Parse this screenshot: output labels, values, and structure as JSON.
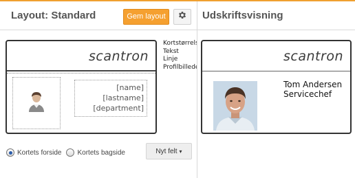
{
  "accent_color": "#f0a030",
  "layout_panel": {
    "title": "Layout: Standard",
    "save_button_label": "Gem layout",
    "settings_icon": "gear-icon",
    "card": {
      "logo": "scantron",
      "placeholder_icon": "person-icon",
      "placeholder_line1": "[name] [lastname]",
      "placeholder_line2": "[department]"
    },
    "side_menu": [
      "Kortstørrelse",
      "Tekst",
      "Linje",
      "Profilbillede"
    ],
    "radios": [
      {
        "label": "Kortets forside",
        "checked": true
      },
      {
        "label": "Kortets bagside",
        "checked": false
      }
    ],
    "new_field_label": "Nyt felt",
    "new_field_caret_icon": "caret-down-icon"
  },
  "preview_panel": {
    "title": "Udskriftsvisning",
    "card": {
      "logo": "scantron",
      "name": "Tom Andersen",
      "job_title": "Servicechef"
    }
  }
}
